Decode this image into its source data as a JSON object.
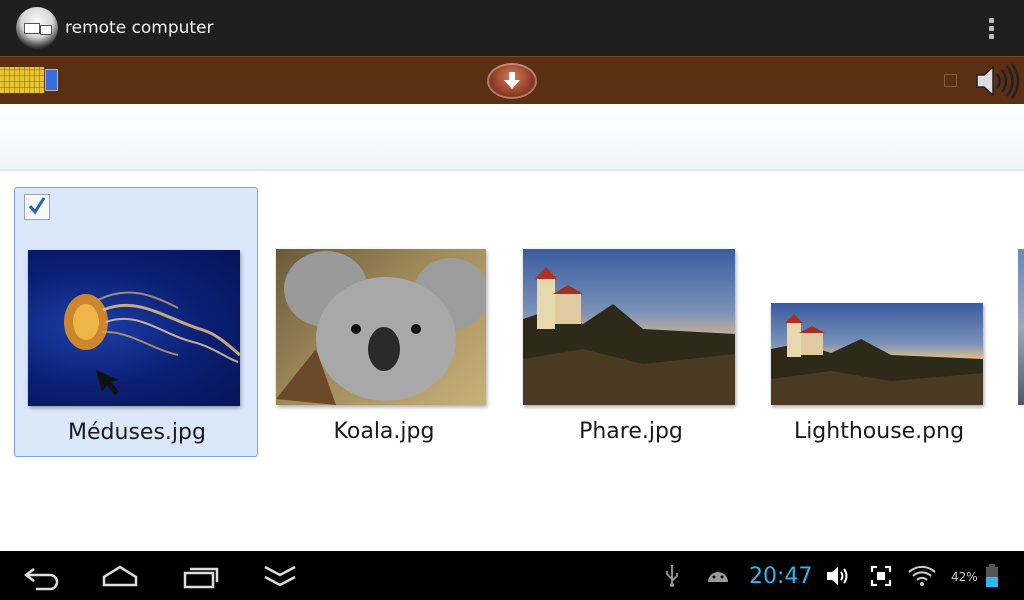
{
  "app": {
    "title": "remote computer"
  },
  "files": [
    {
      "name": "Méduses.jpg",
      "selected": true
    },
    {
      "name": "Koala.jpg",
      "selected": false
    },
    {
      "name": "Phare.jpg",
      "selected": false
    },
    {
      "name": "Lighthouse.png",
      "selected": false
    }
  ],
  "status": {
    "time": "20:47",
    "battery": "42%"
  },
  "colors": {
    "accent_time": "#2fb6ea",
    "toolbar": "#5a2f12",
    "selection": "#dbe8fb"
  },
  "icons": [
    "keyboard-icon",
    "download-icon",
    "speaker-icon",
    "overflow-menu-icon",
    "back-icon",
    "home-icon",
    "recent-apps-icon",
    "hide-keyboard-icon",
    "usb-icon",
    "android-icon",
    "volume-icon",
    "screenshot-icon",
    "wifi-icon",
    "battery-icon"
  ]
}
